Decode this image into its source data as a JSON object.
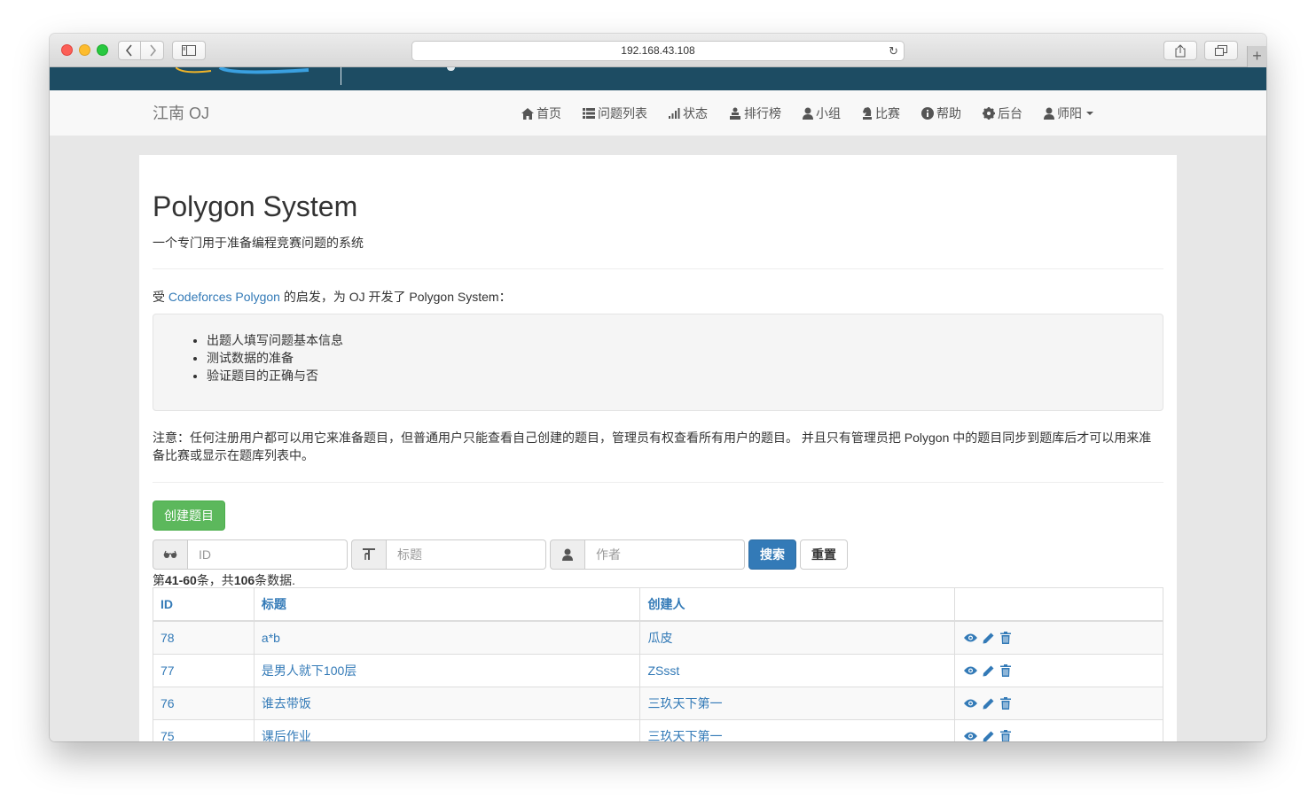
{
  "browser": {
    "url": "192.168.43.108"
  },
  "navbar": {
    "brand": "江南 OJ",
    "items": [
      {
        "label": "首页",
        "icon": "home-icon"
      },
      {
        "label": "问题列表",
        "icon": "list-icon"
      },
      {
        "label": "状态",
        "icon": "signal-icon"
      },
      {
        "label": "排行榜",
        "icon": "podium-icon"
      },
      {
        "label": "小组",
        "icon": "user-icon"
      },
      {
        "label": "比赛",
        "icon": "knight-icon"
      },
      {
        "label": "帮助",
        "icon": "info-icon"
      },
      {
        "label": "后台",
        "icon": "gear-icon"
      },
      {
        "label": "师阳",
        "icon": "user-icon"
      }
    ]
  },
  "page": {
    "title": "Polygon System",
    "subtitle": "一个专门用于准备编程竞赛问题的系统",
    "intro_prefix": "受 ",
    "intro_link": "Codeforces Polygon",
    "intro_suffix": " 的启发，为 OJ 开发了 Polygon System：",
    "features": [
      "出题人填写问题基本信息",
      "测试数据的准备",
      "验证题目的正确与否"
    ],
    "note": "注意：任何注册用户都可以用它来准备题目，但普通用户只能查看自己创建的题目，管理员有权查看所有用户的题目。 并且只有管理员把 Polygon 中的题目同步到题库后才可以用来准备比赛或显示在题库列表中。",
    "create_button": "创建题目"
  },
  "search": {
    "id_placeholder": "ID",
    "title_placeholder": "标题",
    "author_placeholder": "作者",
    "search_button": "搜索",
    "reset_button": "重置"
  },
  "summary": {
    "prefix": "第",
    "range": "41-60",
    "middle": "条，共",
    "total": "106",
    "suffix": "条数据."
  },
  "table": {
    "headers": {
      "id": "ID",
      "title": "标题",
      "creator": "创建人"
    },
    "rows": [
      {
        "id": "78",
        "title": "a*b",
        "creator": "瓜皮"
      },
      {
        "id": "77",
        "title": "是男人就下100层",
        "creator": "ZSsst"
      },
      {
        "id": "76",
        "title": "谁去带饭",
        "creator": "三玖天下第一"
      },
      {
        "id": "75",
        "title": "课后作业",
        "creator": "三玖天下第一"
      }
    ]
  }
}
